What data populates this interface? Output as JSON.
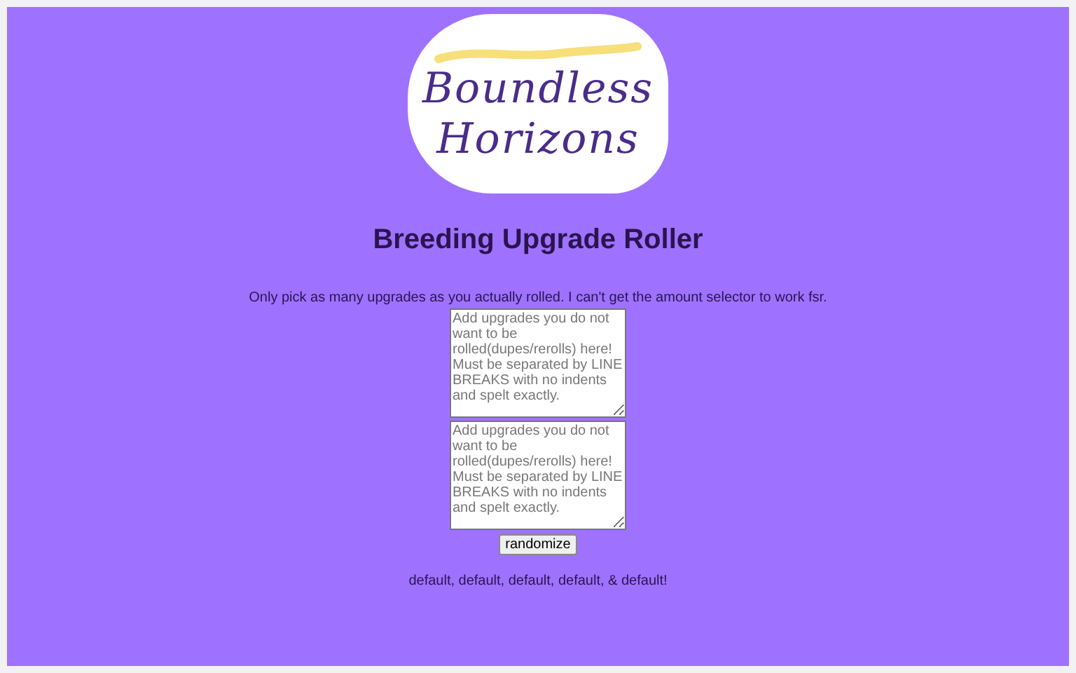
{
  "logo": {
    "line_1": "Boundless",
    "line_2": "Horizons"
  },
  "title": "Breeding Upgrade Roller",
  "instructions": "Only pick as many upgrades as you actually rolled. I can't get the amount selector to work fsr.",
  "fields": [
    {
      "placeholder": "Add upgrades you do not want to be rolled(dupes/rerolls) here! Must be separated by LINE BREAKS with no indents and spelt exactly."
    },
    {
      "placeholder": "Add upgrades you do not want to be rolled(dupes/rerolls) here! Must be separated by LINE BREAKS with no indents and spelt exactly."
    }
  ],
  "button": "randomize",
  "result": "default, default, default, default, & default!"
}
